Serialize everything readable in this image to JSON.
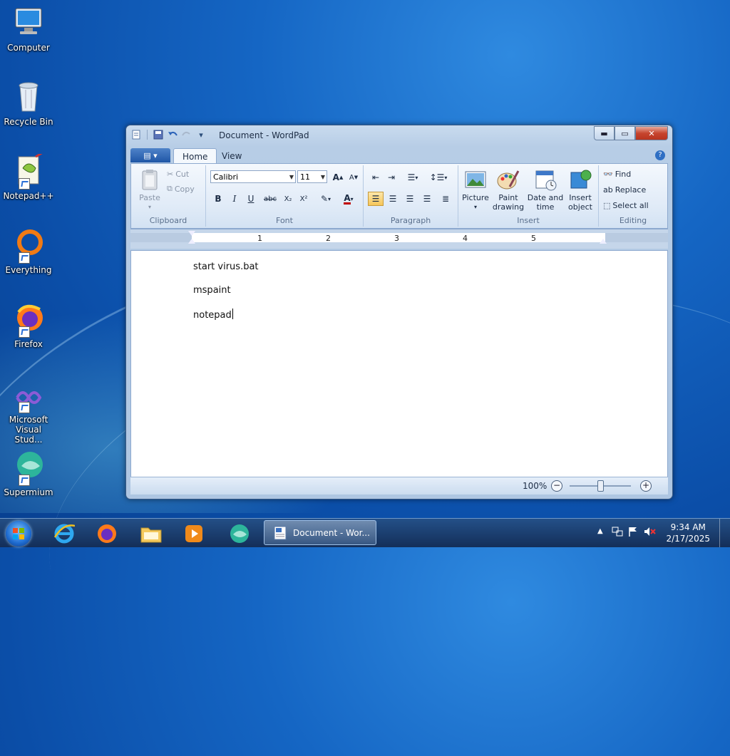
{
  "desktop": {
    "icons": [
      {
        "label": "Computer",
        "icon": "computer-icon"
      },
      {
        "label": "Recycle Bin",
        "icon": "recycle-bin-icon"
      },
      {
        "label": "Notepad++",
        "icon": "notepadpp-icon"
      },
      {
        "label": "Everything",
        "icon": "everything-icon"
      },
      {
        "label": "Firefox",
        "icon": "firefox-icon"
      },
      {
        "label": "Microsoft Visual Stud...",
        "icon": "visual-studio-icon"
      },
      {
        "label": "Supermium",
        "icon": "supermium-icon"
      }
    ]
  },
  "window": {
    "title": "Document - WordPad",
    "tabs": {
      "home": "Home",
      "view": "View"
    },
    "ribbon": {
      "clipboard": {
        "label": "Clipboard",
        "paste": "Paste",
        "cut": "Cut",
        "copy": "Copy"
      },
      "font": {
        "label": "Font",
        "family": "Calibri",
        "size": "11",
        "bold": "B",
        "italic": "I",
        "underline": "U",
        "strike": "abc",
        "subscript": "X₂",
        "superscript": "X²",
        "color_glyph": "A"
      },
      "paragraph": {
        "label": "Paragraph"
      },
      "insert": {
        "label": "Insert",
        "picture": "Picture",
        "paint_drawing_1": "Paint",
        "paint_drawing_2": "drawing",
        "date_time_1": "Date and",
        "date_time_2": "time",
        "insert_object_1": "Insert",
        "insert_object_2": "object"
      },
      "editing": {
        "label": "Editing",
        "find": "Find",
        "replace": "Replace",
        "select_all": "Select all"
      }
    },
    "ruler": {
      "numbers": [
        "1",
        "2",
        "3",
        "4",
        "5"
      ]
    },
    "document": {
      "lines": [
        "start virus.bat",
        "mspaint",
        "notepad"
      ]
    },
    "status": {
      "zoom": "100%",
      "zoom_level": 0.5
    }
  },
  "taskbar": {
    "window_button": "Document - Wor...",
    "time": "9:34 AM",
    "date": "2/17/2025"
  },
  "colors": {
    "accent": "#1f56a6",
    "caption_close": "#c7452f",
    "font_color_bar": "#c00000"
  }
}
